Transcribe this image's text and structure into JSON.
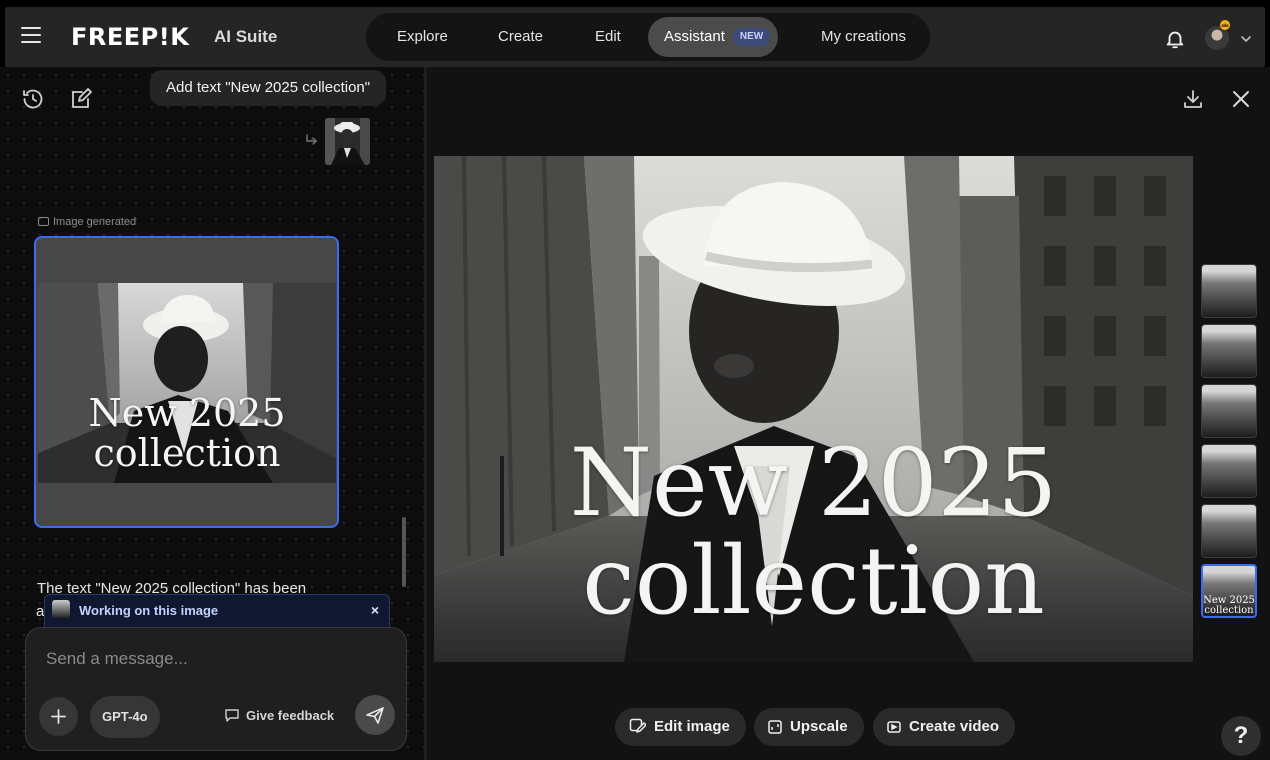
{
  "header": {
    "logo_text": "FREEP!K",
    "suite_label": "AI Suite",
    "nav": [
      {
        "label": "Explore"
      },
      {
        "label": "Create"
      },
      {
        "label": "Edit"
      },
      {
        "label": "Assistant",
        "badge": "NEW",
        "active": true
      },
      {
        "label": "My creations"
      }
    ],
    "icons": [
      "menu-icon",
      "bell-icon",
      "avatar",
      "crown-icon",
      "chevron-down-icon"
    ]
  },
  "chat": {
    "user_message": "Add text \"New 2025 collection\"",
    "generated_label": "Image generated",
    "image_overlay": {
      "line1": "New  2025",
      "line2": "collection"
    },
    "assistant_reply": "The text \"New 2025 collection\" has been",
    "assistant_reply_cont": "a",
    "working_label": "Working on this image",
    "working_close": "×",
    "composer": {
      "placeholder": "Send a message...",
      "model": "GPT-4o",
      "feedback_label": "Give feedback"
    }
  },
  "viewer": {
    "overlay": {
      "line1": "New  2025",
      "line2": "collection"
    },
    "thumb_overlay": {
      "line1": "New 2025",
      "line2": "collection"
    },
    "thumbnails_count": 6,
    "selected_thumbnail": 6,
    "actions": {
      "edit": "Edit image",
      "upscale": "Upscale",
      "video": "Create video"
    },
    "help": "?"
  },
  "colors": {
    "accent": "#3b6cf0",
    "background": "#121212",
    "panel": "#252525"
  }
}
